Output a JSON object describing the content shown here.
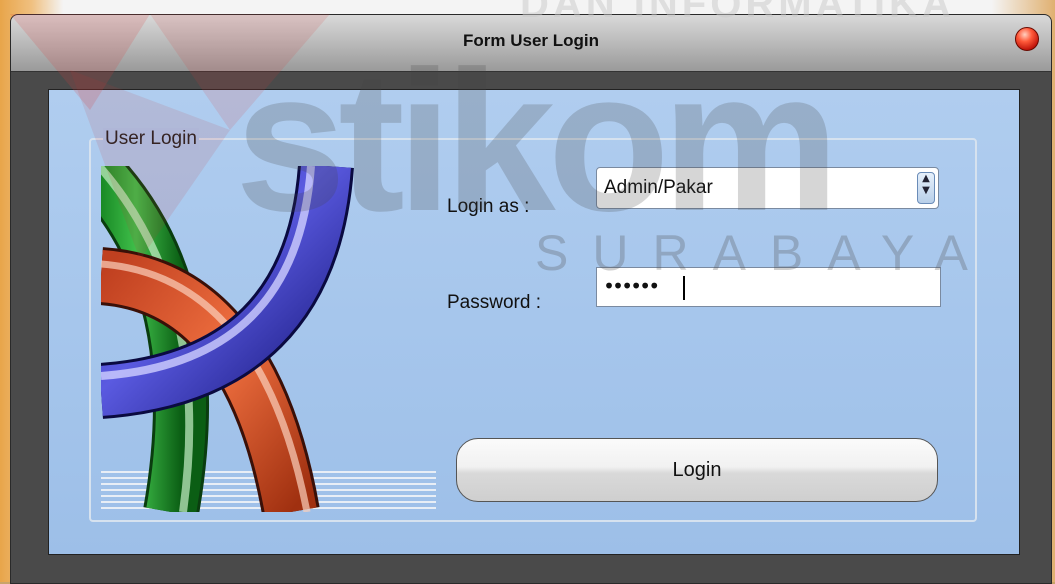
{
  "window": {
    "title": "Form User Login"
  },
  "group": {
    "label": "User Login"
  },
  "form": {
    "login_as_label": "Login as :",
    "login_as_value": "Admin/Pakar",
    "password_label": "Password :",
    "password_value": "••••••",
    "login_button": "Login"
  },
  "watermark": {
    "top": "DAN INFORMATIKA",
    "main": "stikom",
    "sub": "SURABAYA"
  },
  "icons": {
    "close": "close-icon",
    "spin": "up-down-spin-icon"
  },
  "colors": {
    "client_bg": "#a6c6ec",
    "window_frame": "#4a4a4a",
    "close_red": "#e0301a"
  }
}
